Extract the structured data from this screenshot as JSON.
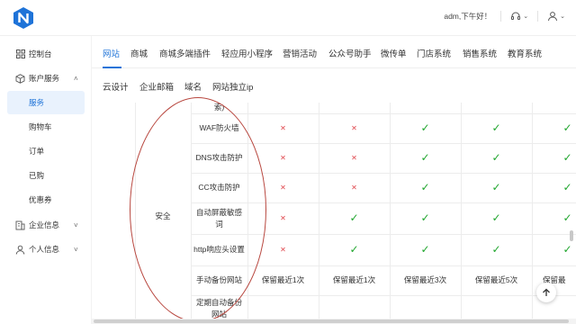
{
  "header": {
    "greeting": "adm,下午好！",
    "brand_color": "#1e73d8"
  },
  "sidebar": {
    "items": [
      {
        "label": "控制台",
        "icon": "grid-icon"
      },
      {
        "label": "账户服务",
        "icon": "cube-icon"
      },
      {
        "label": "服务"
      },
      {
        "label": "购物车"
      },
      {
        "label": "订单"
      },
      {
        "label": "已购"
      },
      {
        "label": "优惠券"
      },
      {
        "label": "企业信息",
        "icon": "building-icon"
      },
      {
        "label": "个人信息",
        "icon": "user-icon"
      }
    ]
  },
  "tabs_primary": [
    "网站",
    "商城",
    "商城多端插件",
    "轻应用小程序",
    "营销活动",
    "公众号助手",
    "微传单",
    "门店系统",
    "销售系统",
    "教育系统"
  ],
  "tabs_secondary": [
    "云设计",
    "企业邮箱",
    "域名",
    "网站独立ip"
  ],
  "table": {
    "category": "安全",
    "top_partial": "索)",
    "rows": [
      {
        "feature": "WAF防火墙",
        "values": [
          "x",
          "x",
          "ok",
          "ok",
          "ok"
        ]
      },
      {
        "feature": "DNS攻击防护",
        "values": [
          "x",
          "x",
          "ok",
          "ok",
          "ok"
        ]
      },
      {
        "feature": "CC攻击防护",
        "values": [
          "x",
          "x",
          "ok",
          "ok",
          "ok"
        ]
      },
      {
        "feature": "自动屏蔽敏感词",
        "values": [
          "x",
          "ok",
          "ok",
          "ok",
          "ok"
        ]
      },
      {
        "feature": "http响应头设置",
        "values": [
          "x",
          "ok",
          "ok",
          "ok",
          "ok"
        ]
      },
      {
        "feature": "手动备份网站",
        "values": [
          "保留最近1次",
          "保留最近1次",
          "保留最近3次",
          "保留最近5次",
          "保留最"
        ]
      },
      {
        "feature": "定期自动备份网站",
        "values": [
          "",
          "",
          "",
          "",
          ""
        ]
      }
    ]
  },
  "colors": {
    "cross": "#e0484e",
    "check": "#21a62f",
    "annotation_circle": "#b8473f"
  }
}
